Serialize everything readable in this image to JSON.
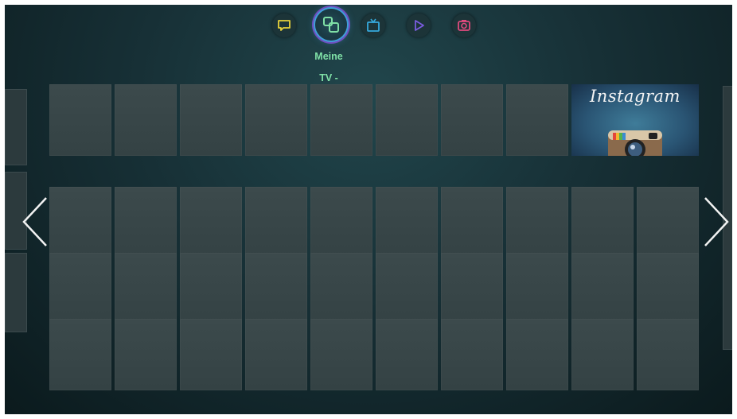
{
  "nav": {
    "items": [
      {
        "id": "social",
        "icon": "speech-bubble-icon",
        "color": "#e8d33a"
      },
      {
        "id": "apps",
        "icon": "apps-icon",
        "color": "#7fe0a6",
        "active": true
      },
      {
        "id": "tv",
        "icon": "tv-icon",
        "color": "#35a9dc"
      },
      {
        "id": "video",
        "icon": "play-icon",
        "color": "#7a5ce0"
      },
      {
        "id": "photo",
        "icon": "camera-icon",
        "color": "#e04a7e"
      }
    ],
    "active_label": "Meine\nTV -\nApps"
  },
  "featured_app": {
    "name": "Instagram",
    "icon": "instagram-camera-icon"
  },
  "grid": {
    "top_row_empty_tiles": 8,
    "rows": 3,
    "columns": 10
  },
  "navigation_arrows": {
    "left": "chevron-left-icon",
    "right": "chevron-right-icon"
  }
}
